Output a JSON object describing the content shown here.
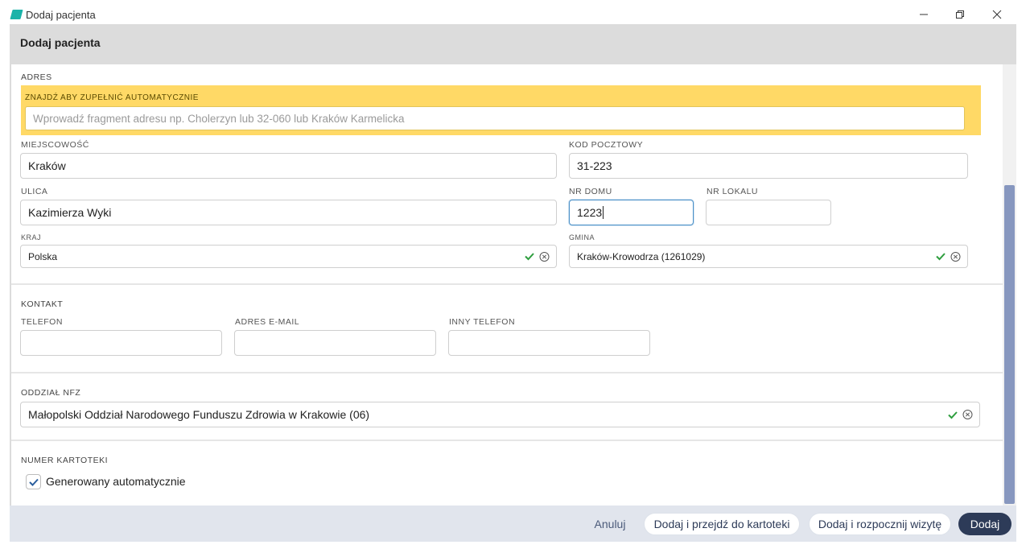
{
  "window": {
    "title": "Dodaj pacjenta"
  },
  "dialog": {
    "title": "Dodaj pacjenta"
  },
  "address": {
    "section_label": "ADRES",
    "autofill_label": "ZNAJDŹ ABY ZUPEŁNIĆ AUTOMATYCZNIE",
    "autofill_placeholder": "Wprowadź fragment adresu np. Cholerzyn lub 32-060 lub Kraków Karmelicka",
    "city_label": "MIEJSCOWOŚĆ",
    "city_value": "Kraków",
    "postal_label": "KOD POCZTOWY",
    "postal_value": "31-223",
    "street_label": "ULICA",
    "street_value": "Kazimierza Wyki",
    "house_label": "NR DOMU",
    "house_value": "1223",
    "apartment_label": "NR LOKALU",
    "apartment_value": "",
    "country_label": "KRAJ",
    "country_value": "Polska",
    "commune_label": "GMINA",
    "commune_value": "Kraków-Krowodrza (1261029)"
  },
  "contact": {
    "section_label": "KONTAKT",
    "phone_label": "TELEFON",
    "phone_value": "",
    "email_label": "ADRES E-MAIL",
    "email_value": "",
    "other_phone_label": "INNY TELEFON",
    "other_phone_value": ""
  },
  "nfz": {
    "section_label": "ODDZIAŁ NFZ",
    "value": "Małopolski Oddział Narodowego Funduszu Zdrowia w Krakowie (06)"
  },
  "file_number": {
    "section_label": "NUMER KARTOTEKI",
    "checkbox_label": "Generowany automatycznie",
    "checked": true
  },
  "footer": {
    "cancel_label": "Anuluj",
    "add_and_open_label": "Dodaj i przejdź do kartoteki",
    "add_and_visit_label": "Dodaj i rozpocznij wizytę",
    "add_label": "Dodaj"
  },
  "colors": {
    "accent": "#2d3b58",
    "autofill_bg": "#ffd966",
    "valid_check": "#2e9e3e",
    "scrollbar": "#8797bf"
  },
  "icons": {
    "valid": "check-icon",
    "clear": "clear-circle-icon"
  }
}
